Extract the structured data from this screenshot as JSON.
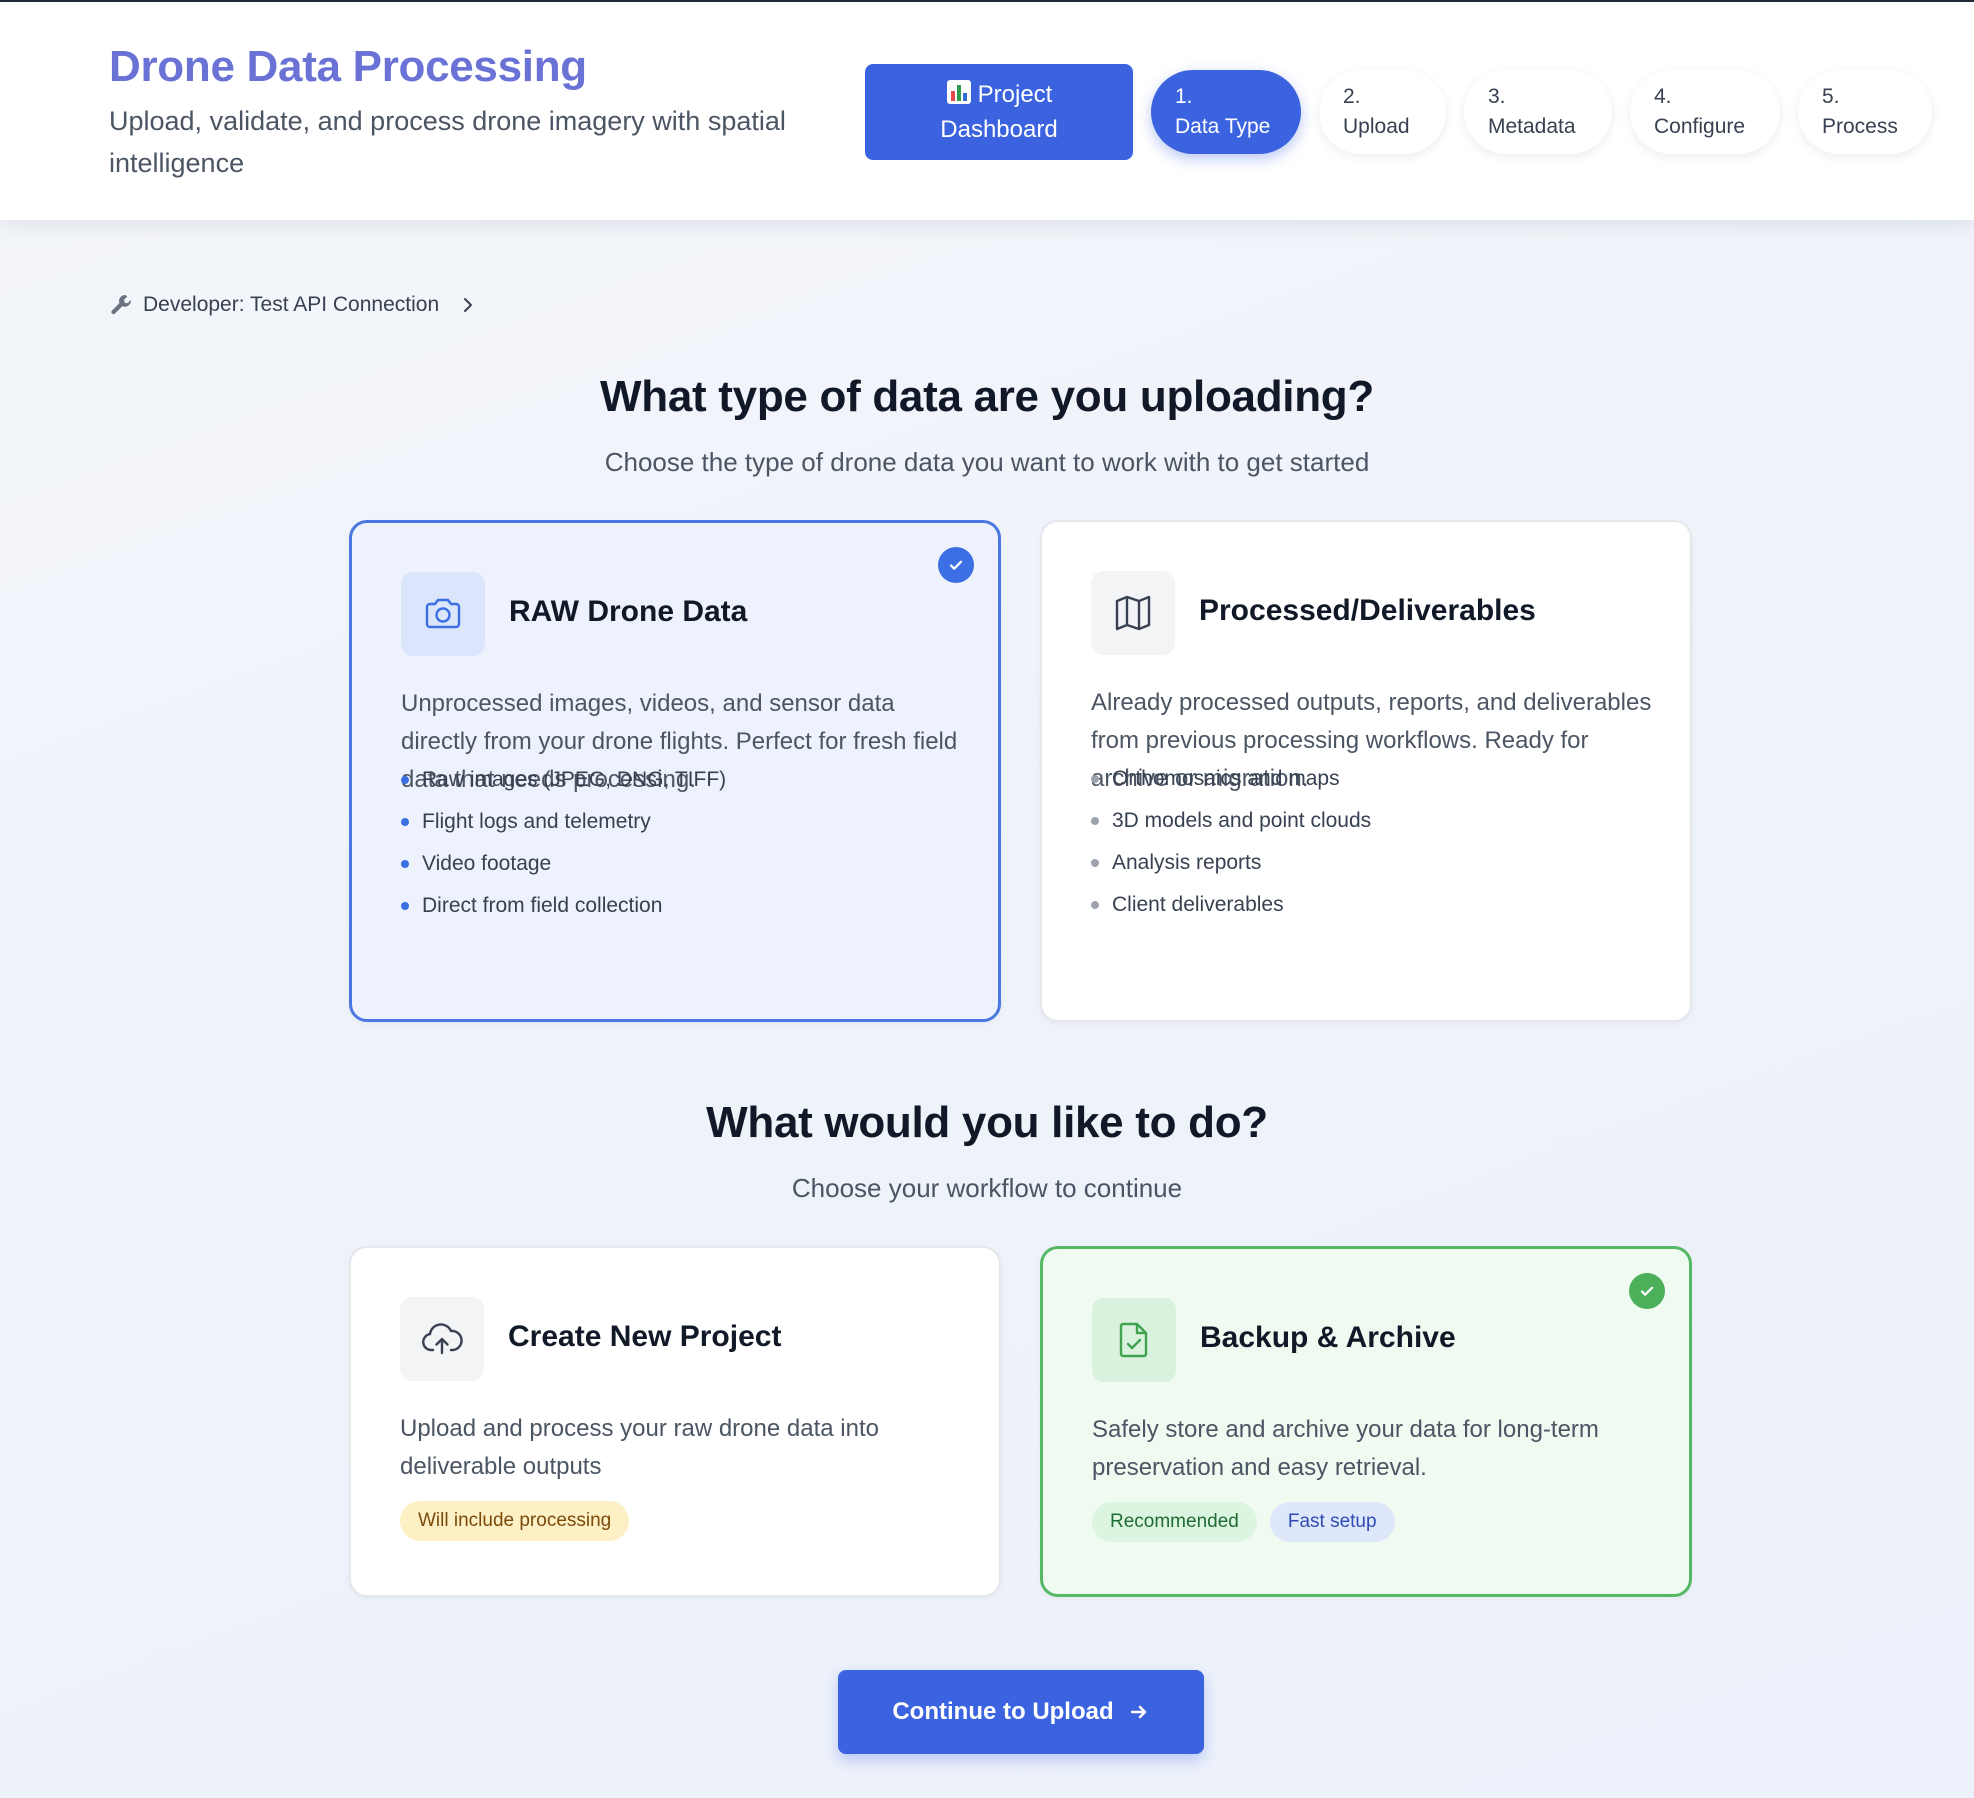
{
  "header": {
    "title": "Drone Data Processing",
    "subtitle": "Upload, validate, and process drone imagery with spatial intelligence",
    "dashboard_button": "Project Dashboard",
    "steps": [
      {
        "num": "1.",
        "label": "Data Type",
        "active": true
      },
      {
        "num": "2.",
        "label": "Upload",
        "active": false
      },
      {
        "num": "3.",
        "label": "Metadata",
        "active": false
      },
      {
        "num": "4.",
        "label": "Configure",
        "active": false
      },
      {
        "num": "5.",
        "label": "Process",
        "active": false
      }
    ]
  },
  "dev_link": {
    "icon": "🔧",
    "label": "Developer: Test API Connection"
  },
  "data_type": {
    "title": "What type of data are you uploading?",
    "subtitle": "Choose the type of drone data you want to work with to get started",
    "options": [
      {
        "title": "RAW Drone Data",
        "description": "Unprocessed images, videos, and sensor data directly from your drone flights. Perfect for fresh field data that needs processing.",
        "items": [
          "Raw images (JPEG, DNG, TIFF)",
          "Flight logs and telemetry",
          "Video footage",
          "Direct from field collection"
        ],
        "selected": true,
        "icon": "camera-icon"
      },
      {
        "title": "Processed/Deliverables",
        "description": "Already processed outputs, reports, and deliverables from previous processing workflows. Ready for archive or migration.",
        "items": [
          "Orthomosaics and maps",
          "3D models and point clouds",
          "Analysis reports",
          "Client deliverables"
        ],
        "selected": false,
        "icon": "map-icon"
      }
    ]
  },
  "workflow": {
    "title": "What would you like to do?",
    "subtitle": "Choose your workflow to continue",
    "options": [
      {
        "title": "Create New Project",
        "description": "Upload and process your raw drone data into deliverable outputs",
        "badges": [
          "Will include processing"
        ],
        "selected": false,
        "icon": "cloud-upload-icon"
      },
      {
        "title": "Backup & Archive",
        "description": "Safely store and archive your data for long-term preservation and easy retrieval.",
        "badges": [
          "Recommended",
          "Fast setup"
        ],
        "selected": true,
        "icon": "file-check-icon"
      }
    ]
  },
  "continue_button": "Continue to Upload",
  "colors": {
    "accent": "#3b63e0",
    "title": "#6b72d6",
    "selected_blue": "#4a78e0",
    "selected_green": "#56b865"
  }
}
